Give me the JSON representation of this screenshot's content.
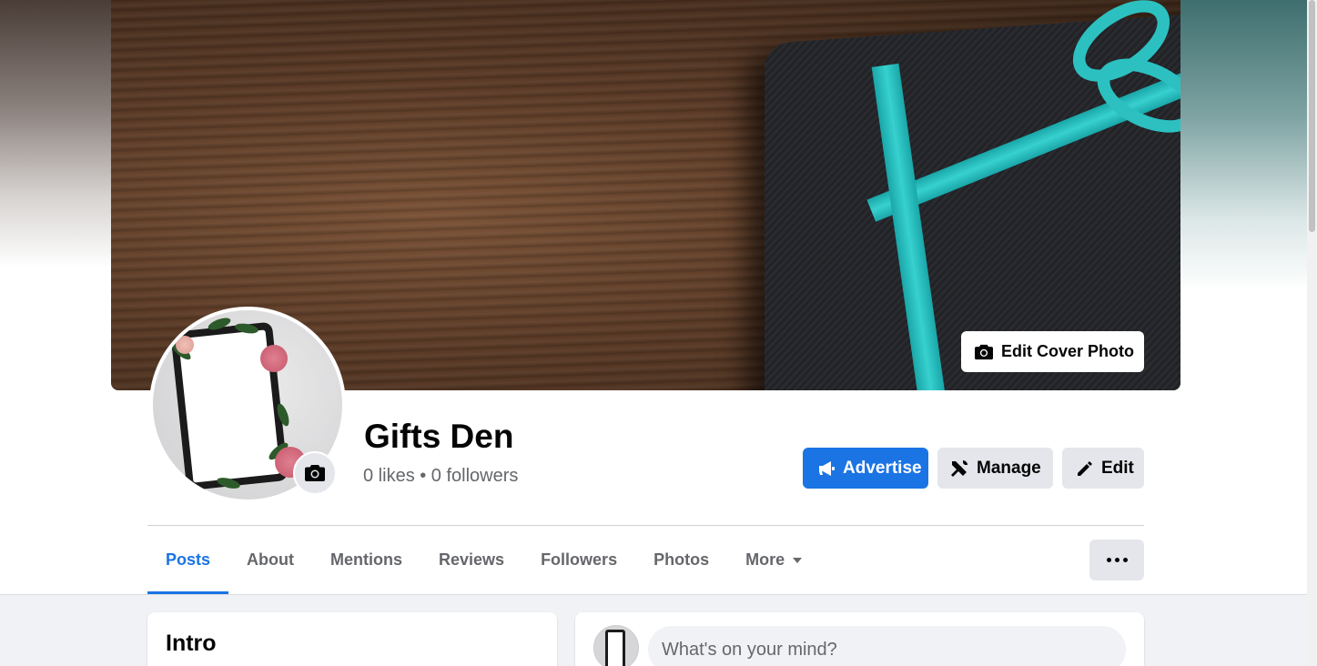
{
  "cover": {
    "edit_cover_label": "Edit Cover Photo"
  },
  "page": {
    "name": "Gifts Den",
    "stats": "0 likes • 0 followers"
  },
  "actions": {
    "advertise": "Advertise",
    "manage": "Manage",
    "edit": "Edit"
  },
  "tabs": [
    {
      "label": "Posts",
      "active": true
    },
    {
      "label": "About"
    },
    {
      "label": "Mentions"
    },
    {
      "label": "Reviews"
    },
    {
      "label": "Followers"
    },
    {
      "label": "Photos"
    },
    {
      "label": "More"
    }
  ],
  "intro": {
    "title": "Intro"
  },
  "composer": {
    "placeholder": "What's on your mind?"
  },
  "colors": {
    "primary": "#1b74e4",
    "secondary_button": "#e4e6eb",
    "muted_text": "#65676b",
    "page_bg": "#f0f2f5"
  },
  "icons": [
    "camera-icon",
    "megaphone-icon",
    "tools-icon",
    "pencil-icon",
    "caret-down-icon",
    "more-dots-icon"
  ]
}
